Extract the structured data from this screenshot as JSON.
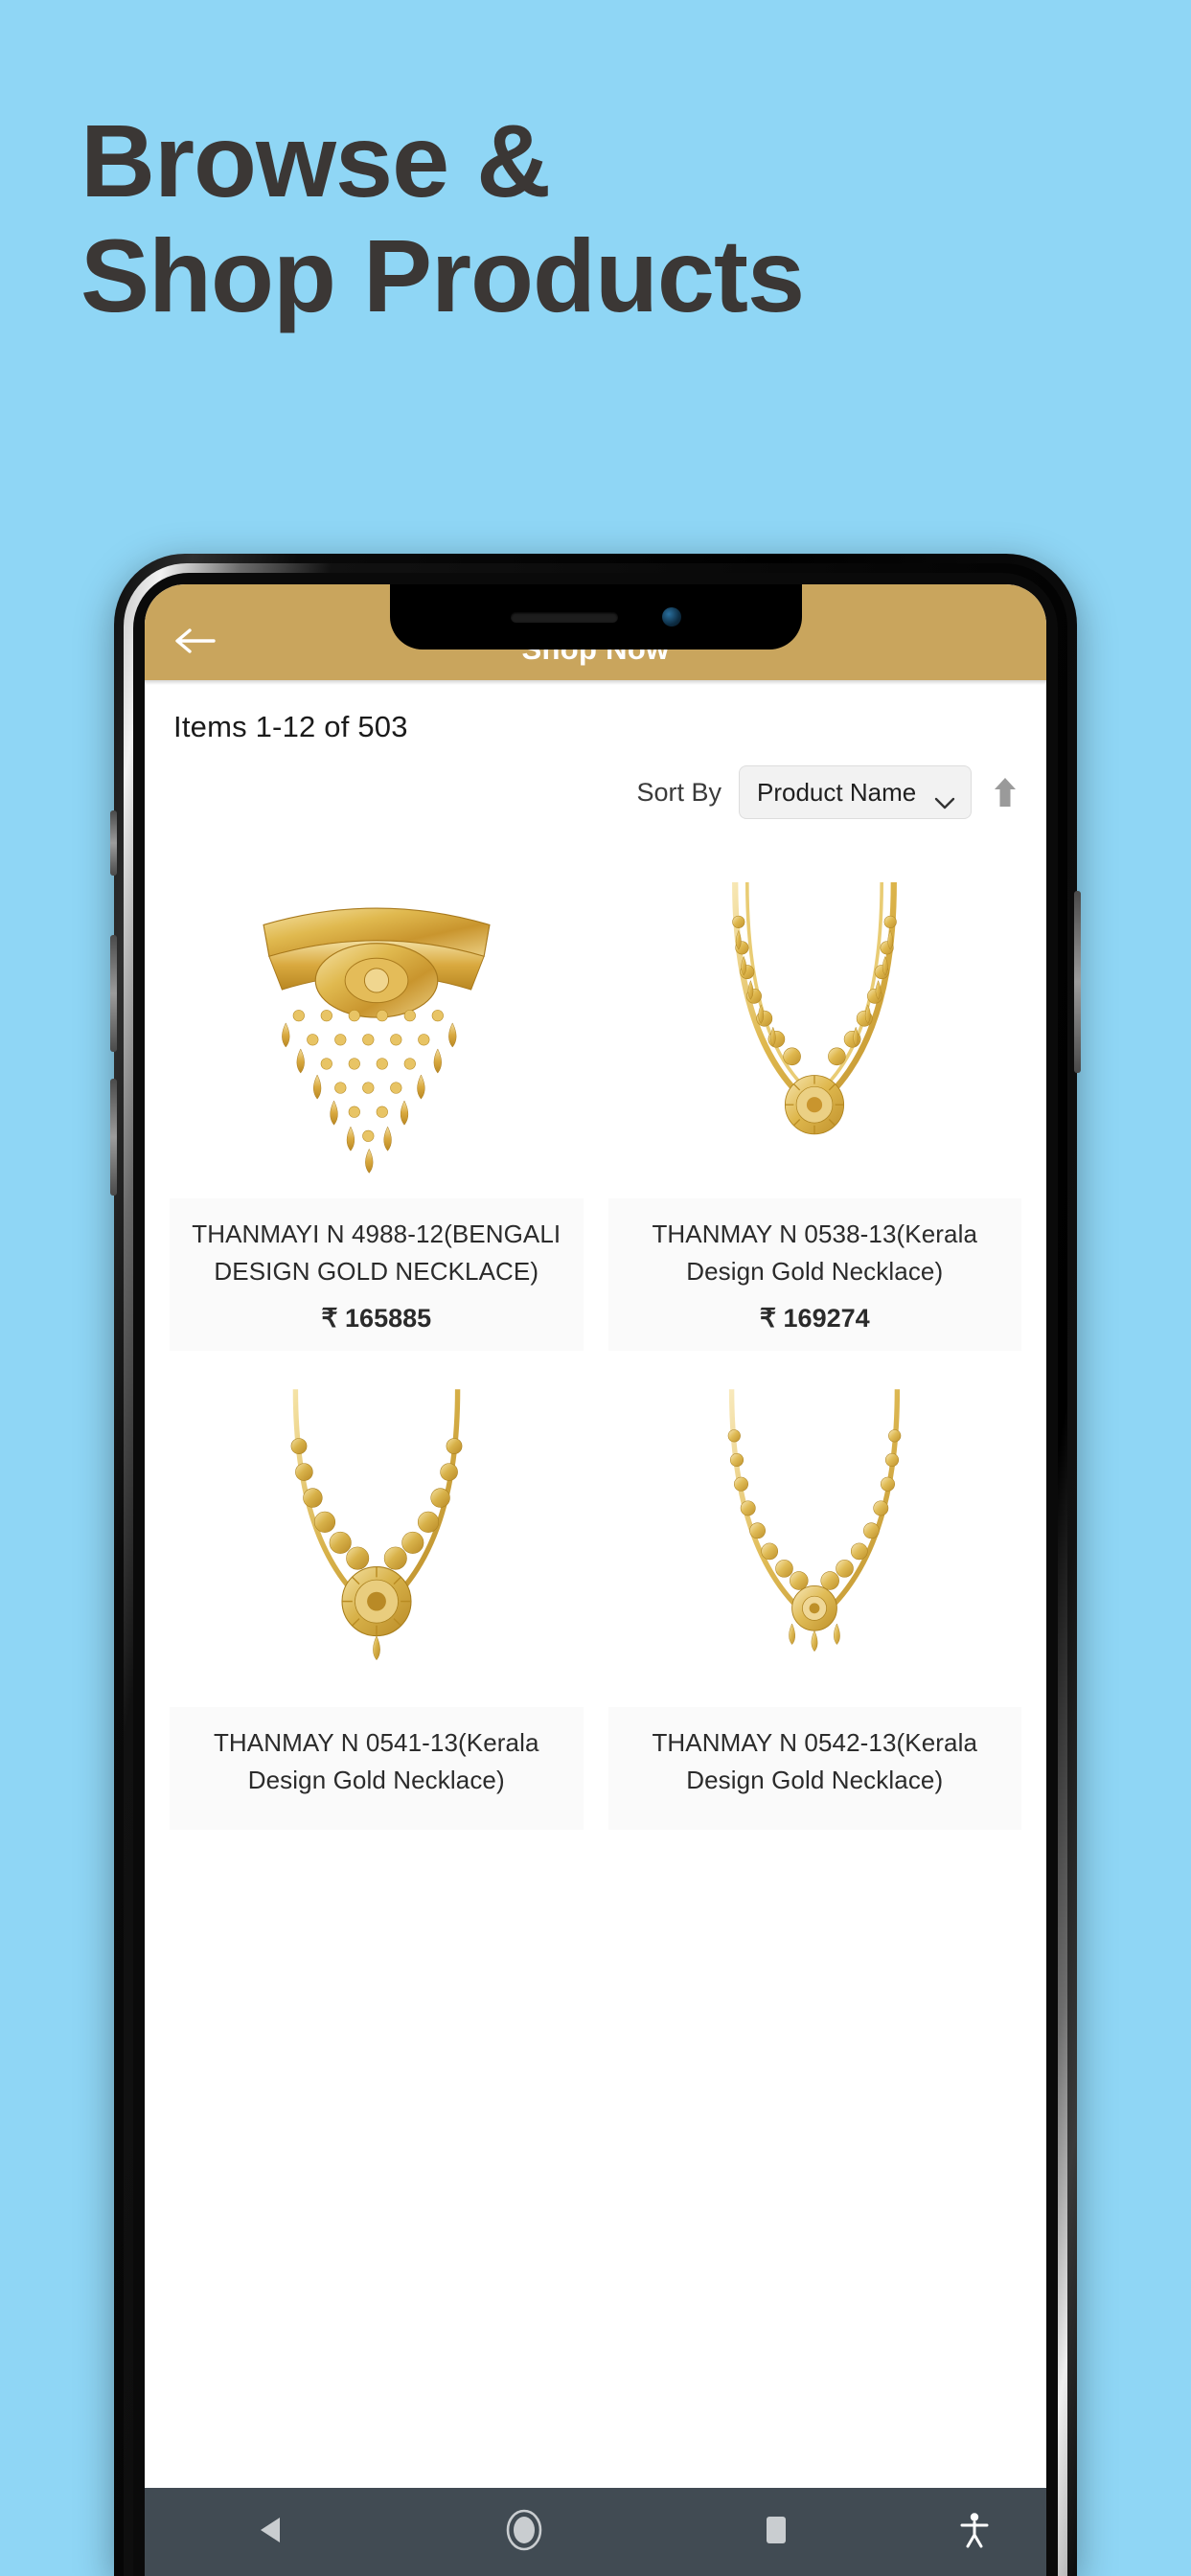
{
  "page": {
    "background_color": "#8FD6F5",
    "headline_lines": [
      "Browse &",
      "Shop Products"
    ],
    "headline_color": "#3B3735"
  },
  "phone": {
    "notch": {
      "speaker_icon": "speaker-grille",
      "camera_icon": "front-camera"
    },
    "side_buttons": [
      "volume-up",
      "volume-down",
      "silent-switch",
      "power-button"
    ]
  },
  "appbar": {
    "title": "Shop Now",
    "back_icon": "back-arrow-icon",
    "background_color": "#C9A55D",
    "title_color": "#FFFFFF"
  },
  "toolbar": {
    "items_count": "Items 1-12 of 503",
    "sort_label": "Sort By",
    "sort_value": "Product Name",
    "sort_options": [
      "Product Name"
    ],
    "sort_chevron_icon": "chevron-down-icon",
    "sort_direction_icon": "arrow-up-icon"
  },
  "products": [
    {
      "title": "THANMAYI N 4988-12(BENGALI DESIGN GOLD NECKLACE)",
      "price": "₹ 165885",
      "image_name": "bengali-design-gold-necklace"
    },
    {
      "title": "THANMAY N 0538-13(Kerala Design Gold Necklace)",
      "price": "₹ 169274",
      "image_name": "kerala-design-gold-necklace-0538"
    },
    {
      "title": "THANMAY N 0541-13(Kerala Design Gold Necklace)",
      "price": "",
      "image_name": "kerala-design-gold-necklace-0541"
    },
    {
      "title": "THANMAY N 0542-13(Kerala Design Gold Necklace)",
      "price": "",
      "image_name": "kerala-design-gold-necklace-0542"
    }
  ],
  "navbar": {
    "background_color": "#414B53",
    "buttons": [
      {
        "name": "back-button",
        "icon": "triangle-back-icon"
      },
      {
        "name": "home-button",
        "icon": "circle-home-icon"
      },
      {
        "name": "recents-button",
        "icon": "square-recents-icon"
      },
      {
        "name": "accessibility-button",
        "icon": "accessibility-icon"
      }
    ]
  }
}
